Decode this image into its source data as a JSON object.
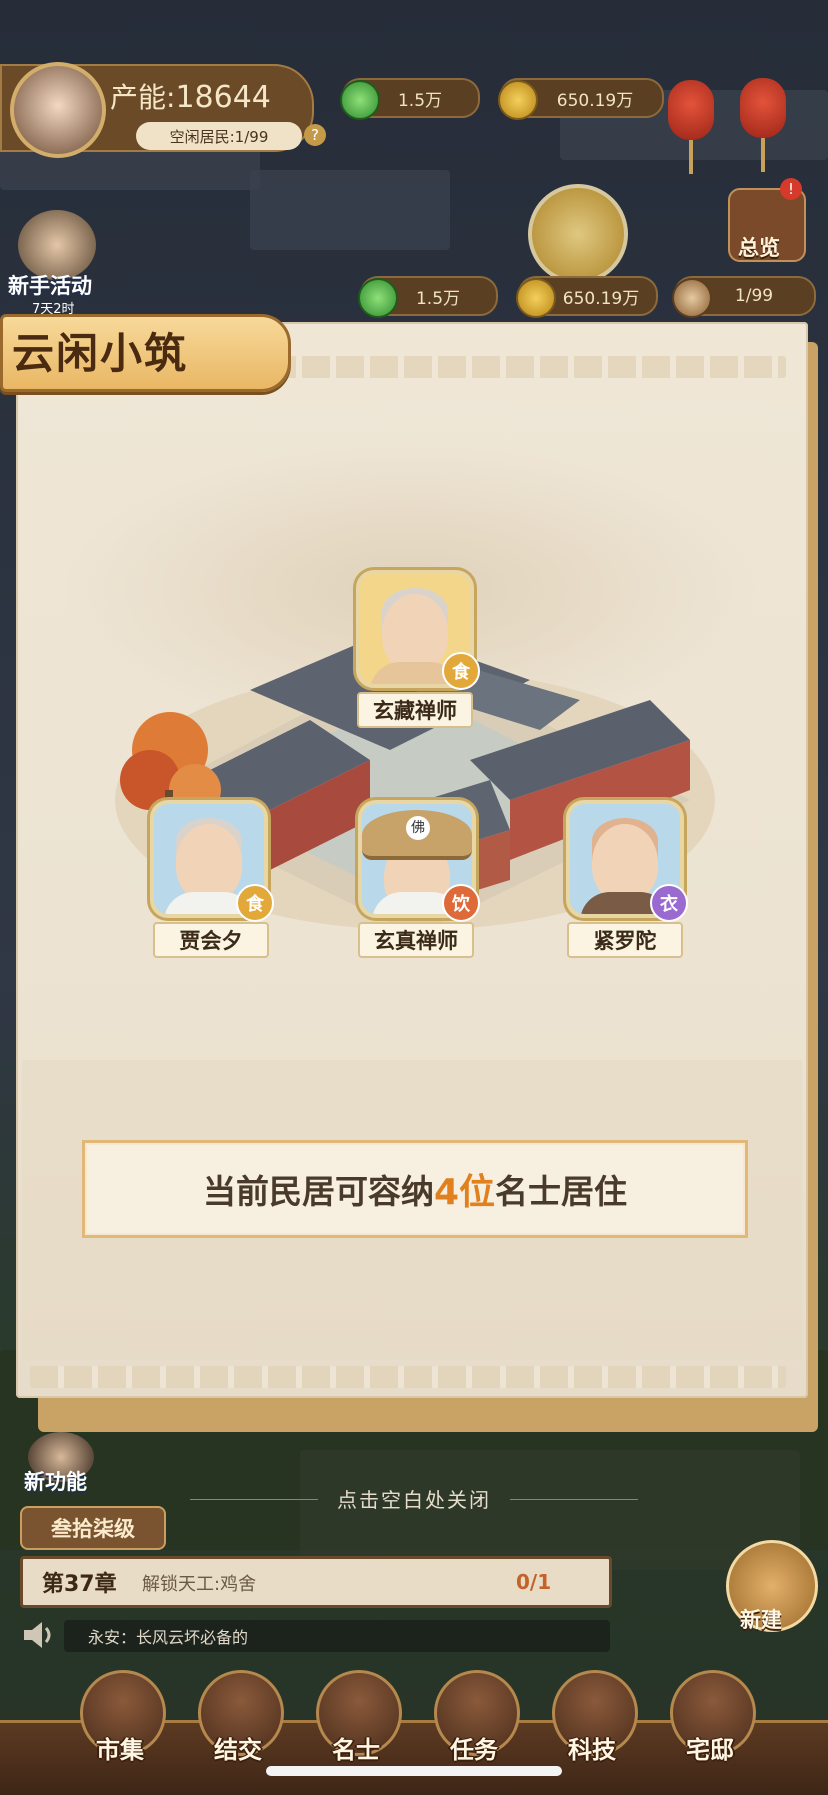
{
  "hud": {
    "production_label": "产能:",
    "production_value": "18644",
    "idle_residents": "空闲居民:1/99",
    "help": "?",
    "jade_top": "1.5万",
    "coins_top": "650.19万",
    "overview": "总览",
    "newbie_event": "新手活动",
    "newbie_timer": "7天2时",
    "resources": {
      "jade": "1.5万",
      "coins": "650.19万",
      "residents": "1/99"
    }
  },
  "panel": {
    "title": "云闲小筑",
    "residents": [
      {
        "name": "玄藏禅师",
        "badge": "食"
      },
      {
        "name": "贾会夕",
        "badge": "食"
      },
      {
        "name": "玄真禅师",
        "badge": "饮"
      },
      {
        "name": "紧罗陀",
        "badge": "衣"
      }
    ],
    "capacity_prefix": "当前民居可容纳",
    "capacity_highlight": "4位",
    "capacity_suffix": "名士居住",
    "hat_char": "佛"
  },
  "close_hint": "点击空白处关闭",
  "left_side": {
    "new_feature": "新功能",
    "level": "叁拾柒级"
  },
  "quest": {
    "chapter": "第37章",
    "task": "解锁天工:鸡舍",
    "progress": "0/1"
  },
  "new_build": "新建",
  "broadcast": "永安：长风云坏必备的",
  "bottom_nav": [
    {
      "label": "市集"
    },
    {
      "label": "结交"
    },
    {
      "label": "名士"
    },
    {
      "label": "任务"
    },
    {
      "label": "科技"
    },
    {
      "label": "宅邸"
    }
  ],
  "colors": {
    "accent_orange": "#e0801e",
    "badge_food": "#e2a83a",
    "badge_drink": "#de6a3a",
    "badge_cloth": "#9a6ad0"
  }
}
